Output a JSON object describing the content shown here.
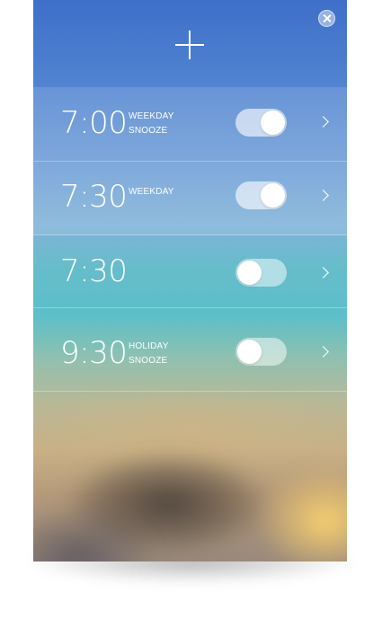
{
  "colors": {
    "header_blue": "#3e6fca",
    "text": "#ffffff"
  },
  "header": {
    "add_icon": "plus-icon",
    "close_icon": "close-icon"
  },
  "alarms": [
    {
      "time": "7:00",
      "labels": [
        "WEEKDAY",
        "SNOOZE"
      ],
      "enabled": true
    },
    {
      "time": "7:30",
      "labels": [
        "WEEKDAY"
      ],
      "enabled": true
    },
    {
      "time": "7:30",
      "labels": [],
      "enabled": false
    },
    {
      "time": "9:30",
      "labels": [
        "HOLIDAY",
        "SNOOZE"
      ],
      "enabled": false
    }
  ]
}
